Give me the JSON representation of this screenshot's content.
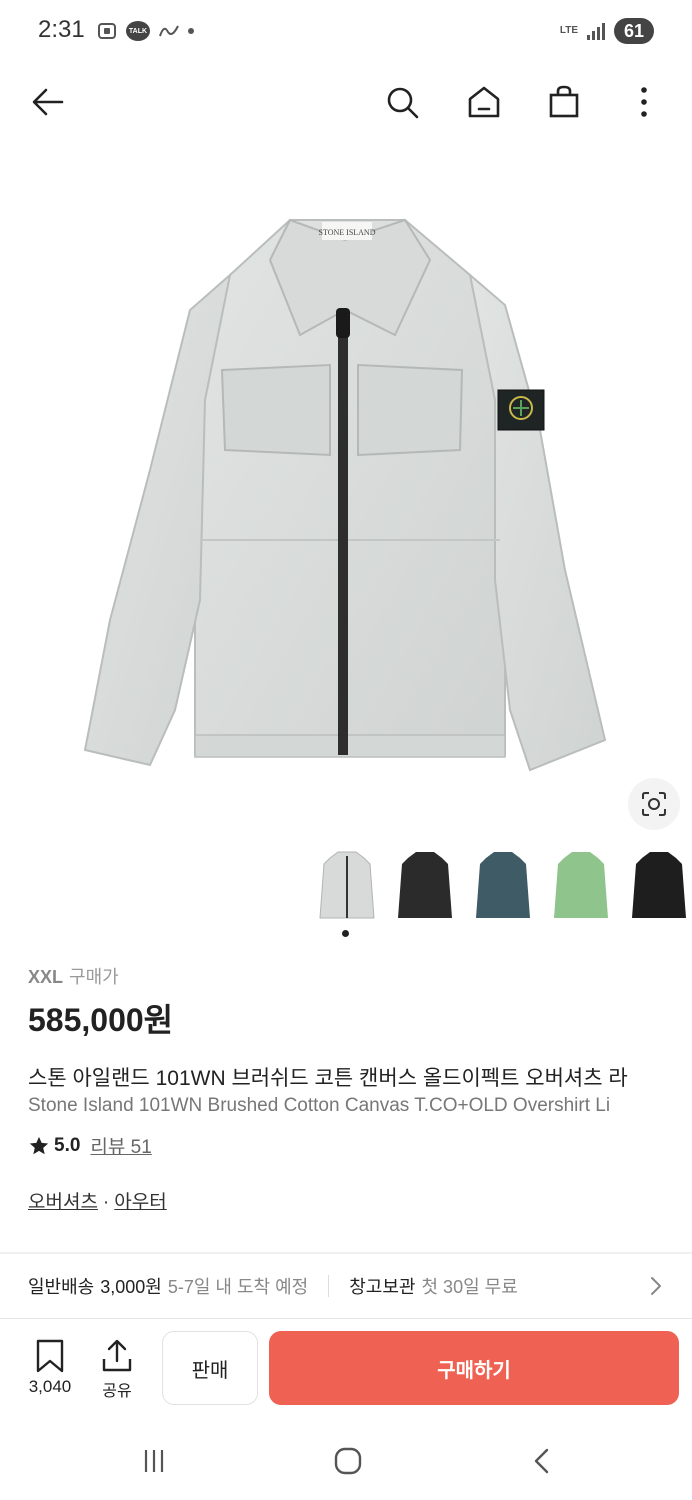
{
  "status_bar": {
    "time": "2:31",
    "talk_label": "TALK",
    "network": "LTE",
    "battery": "61"
  },
  "nav": {
    "back_icon": "arrow-left-icon",
    "search_icon": "search-icon",
    "home_icon": "home-icon",
    "bag_icon": "shopping-bag-icon",
    "more_icon": "more-vertical-icon"
  },
  "product": {
    "brand_label_on_image": "STONE ISLAND",
    "size": "XXL",
    "price_caption": "구매가",
    "price": "585,000원",
    "title_ko": "스톤 아일랜드 101WN 브러쉬드 코튼 캔버스 올드이펙트 오버셔츠 라",
    "title_en": "Stone Island 101WN Brushed Cotton Canvas T.CO+OLD Overshirt Li",
    "rating": "5.0",
    "review_label": "리뷰 51",
    "category_1": "오버셔츠",
    "category_separator": "·",
    "category_2": "아우터",
    "thumbnail_colors": [
      "#d7dad8",
      "#2b2b2b",
      "#3f5b66",
      "#8fc48c",
      "#1e1e1e"
    ]
  },
  "shipping": {
    "label": "일반배송",
    "fee": "3,000원",
    "date": "5-7일 내 도착 예정",
    "storage_label": "창고보관",
    "storage_note": "첫 30일 무료"
  },
  "actions": {
    "wish_count": "3,040",
    "share_label": "공유",
    "sell_label": "판매",
    "buy_label": "구매하기",
    "buy_color": "#ef6253"
  }
}
